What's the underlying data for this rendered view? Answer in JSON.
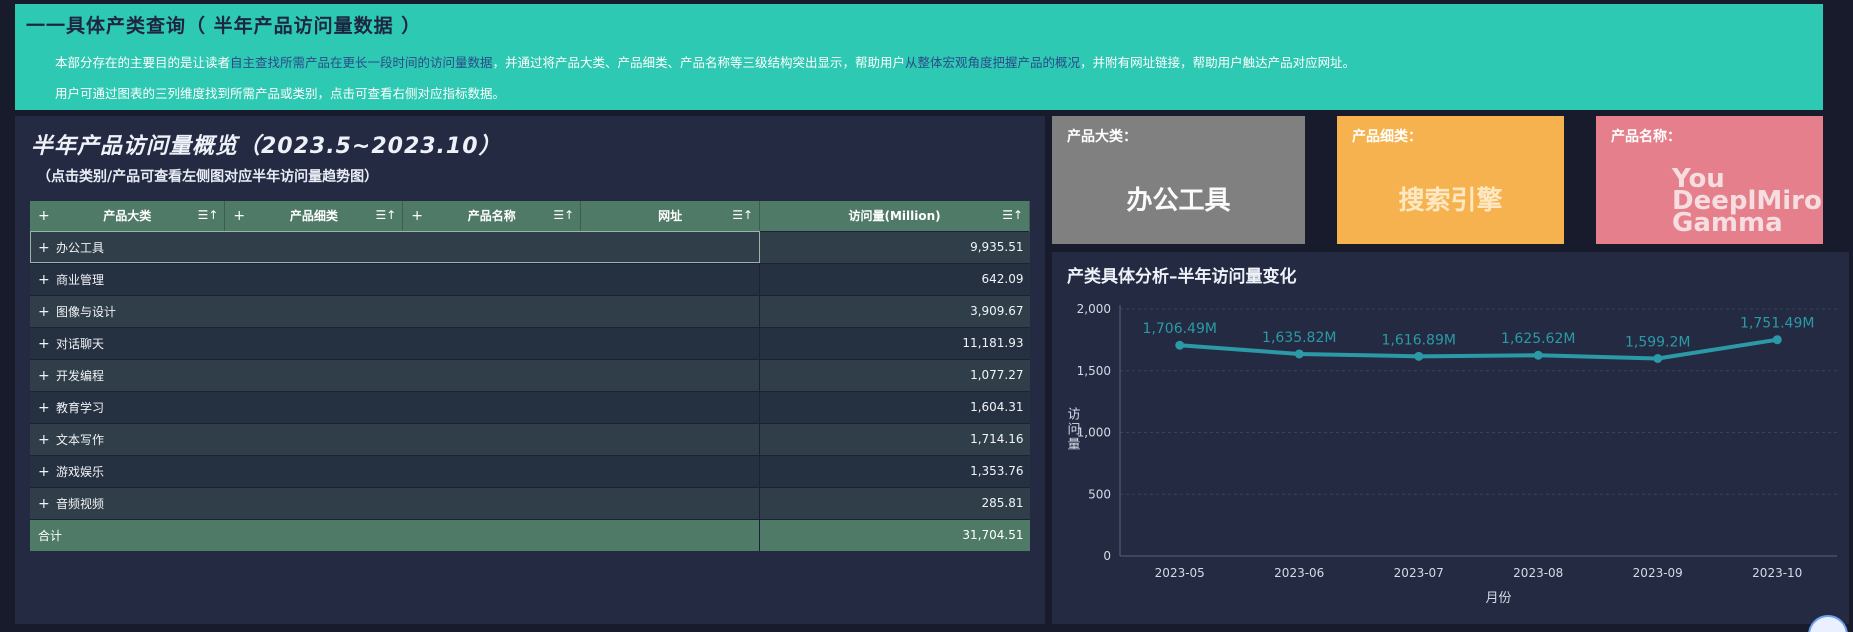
{
  "banner": {
    "title": "一一具体产类查询（ 半年产品访问量数据 ）",
    "line1_a": "本部分存在的主要目的是让读者",
    "line1_b": "自主查找所需产品在更长一段时间的访问量数据",
    "line1_c": "，并通过将产品大类、产品细类、产品名称等三级结构突出显示，帮助用户",
    "line1_d": "从整体宏观角度把握产品的概况",
    "line1_e": "，并附有网址链接，帮助用户触达产品对应网址。",
    "line2": "用户可通过图表的三列维度找到所需产品或类别，点击可查看右侧对应指标数据。"
  },
  "overview": {
    "title": "半年产品访问量概览（2023.5~2023.10）",
    "subtitle": "（点击类别/产品可查看左侧图对应半年访问量趋势图）"
  },
  "table": {
    "headers": [
      "产品大类",
      "产品细类",
      "产品名称",
      "网址",
      "访问量(Million)"
    ],
    "plus": "+",
    "sort": "☰↑",
    "rows": [
      {
        "category": "办公工具",
        "value": "9,935.51"
      },
      {
        "category": "商业管理",
        "value": "642.09"
      },
      {
        "category": "图像与设计",
        "value": "3,909.67"
      },
      {
        "category": "对话聊天",
        "value": "11,181.93"
      },
      {
        "category": "开发编程",
        "value": "1,077.27"
      },
      {
        "category": "教育学习",
        "value": "1,604.31"
      },
      {
        "category": "文本写作",
        "value": "1,714.16"
      },
      {
        "category": "游戏娱乐",
        "value": "1,353.76"
      },
      {
        "category": "音频视频",
        "value": "285.81"
      }
    ],
    "total_label": "合计",
    "total_value": "31,704.51"
  },
  "cards": [
    {
      "label": "产品大类：",
      "value": "办公工具",
      "color": "#808080"
    },
    {
      "label": "产品细类：",
      "value": "搜索引擎",
      "color": "#f6b24e"
    },
    {
      "label": "产品名称：",
      "value_lines": [
        "You",
        "DeeplMiro",
        "Gamma"
      ],
      "color": "#e57f8b"
    }
  ],
  "chart_panel_title": "产类具体分析–半年访问量变化",
  "chart_data": {
    "type": "line",
    "x": [
      "2023-05",
      "2023-06",
      "2023-07",
      "2023-08",
      "2023-09",
      "2023-10"
    ],
    "values": [
      1706.49,
      1635.82,
      1616.89,
      1625.62,
      1599.2,
      1751.49
    ],
    "data_labels": [
      "1,706.49M",
      "1,635.82M",
      "1,616.89M",
      "1,625.62M",
      "1,599.2M",
      "1,751.49M"
    ],
    "y_ticks": [
      "0",
      "500",
      "1,000",
      "1,500",
      "2,000"
    ],
    "ylim": [
      0,
      2000
    ],
    "xlabel": "月份",
    "ylabel": "访问量",
    "grid": true,
    "line_color": "#2b9aa6"
  }
}
